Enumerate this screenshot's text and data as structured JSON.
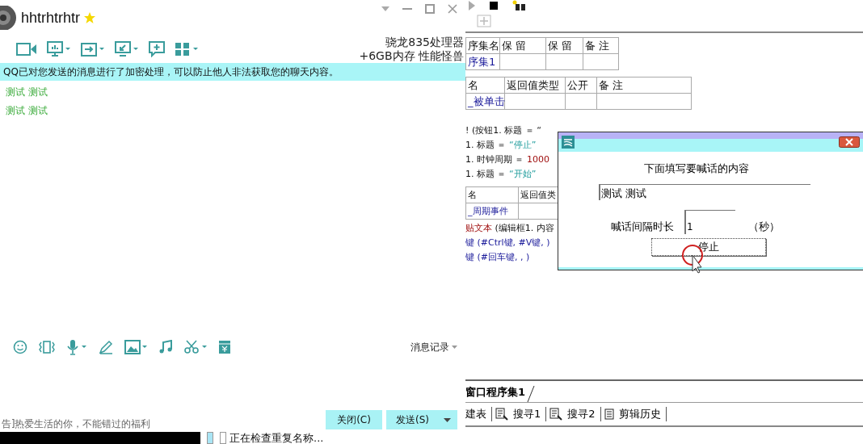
{
  "chat_window": {
    "contact_name": "hhtrhtrhtr",
    "ad_lines": [
      "骁龙835处理器",
      "+6GB内存 性能怪兽"
    ],
    "notice": "QQ已对您发送的消息进行了加密处理，可以防止他人非法获取您的聊天内容。",
    "messages": [
      "测试 测试",
      "测试 测试"
    ],
    "history_button": "消息记录",
    "ad_link": "告]热爱生活的你，不能错过的福利",
    "buttons": [
      {
        "label": "关闭(C)",
        "kind": "plain"
      },
      {
        "label": "发送(S)",
        "kind": "split"
      }
    ]
  },
  "ide": {
    "class_table": {
      "columns": [
        "序集名",
        "保 留",
        "保 留",
        "备 注"
      ],
      "rows": [
        [
          "序集1",
          "",
          "",
          ""
        ]
      ]
    },
    "method_table": {
      "columns": [
        "名",
        "返回值类型",
        "公开",
        "备 注"
      ],
      "rows": [
        [
          "_被单击",
          "",
          "",
          ""
        ]
      ]
    },
    "code_block_1": [
      [
        {
          "text": "! (按钮1. 标题 ＝ “",
          "kind": "plain"
        }
      ],
      [
        {
          "text": "1. 标题 ＝ ",
          "kind": "plain"
        },
        {
          "text": "“停止”",
          "kind": "string"
        }
      ],
      [
        {
          "text": "1. 时钟周期 ＝ ",
          "kind": "plain"
        },
        {
          "text": "1000",
          "kind": "number"
        }
      ],
      [
        {
          "text": "1. 标题 ＝ ",
          "kind": "plain"
        },
        {
          "text": "“开始”",
          "kind": "string"
        }
      ]
    ],
    "event_table": {
      "columns": [
        "名",
        "返回值类"
      ],
      "rows": [
        [
          "_周期事件",
          ""
        ]
      ]
    },
    "code_block_2": [
      [
        {
          "text": "贴文本",
          "kind": "command"
        },
        {
          "text": " (编辑框1. 内容",
          "kind": "plain"
        }
      ],
      [
        {
          "text": "键 (#Ctrl键, #V键, )",
          "kind": "call"
        }
      ],
      [
        {
          "text": "键 (#回车键, , )",
          "kind": "call"
        }
      ]
    ],
    "bottom_tabs": [
      {
        "label": "窗口程序集1",
        "selected": true
      }
    ],
    "bottom_toolbar": [
      {
        "label": "建表",
        "kind": "plain"
      },
      {
        "label": "搜寻1",
        "kind": "search"
      },
      {
        "label": "搜寻2",
        "kind": "search"
      },
      {
        "label": "剪辑历史",
        "kind": "document"
      }
    ]
  },
  "dialog": {
    "prompt": "下面填写要喊话的内容",
    "message_value": "测试 测试",
    "interval_label": "喊话间隔时长",
    "interval_value": "1",
    "unit": "（秒）",
    "button": "停止"
  },
  "status_text": "正在检查重复名称..."
}
